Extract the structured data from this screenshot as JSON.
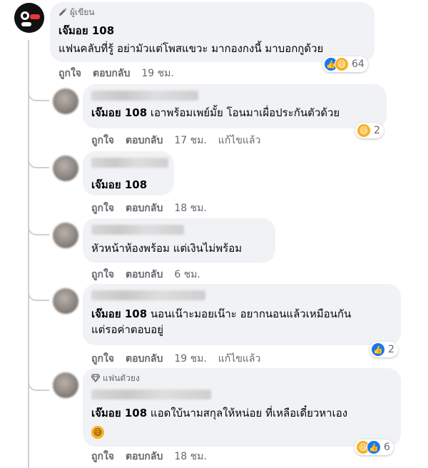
{
  "comments": [
    {
      "author_role": "ผู้เขียน",
      "name": "เจ๊มอย 108",
      "text": "แฟนคลับที่รู้ อย่ามัวแต่โพสแขวะ มากองกงนี้ มาบอกกูด้วย",
      "actions": {
        "like": "ถูกใจ",
        "reply": "ตอบกลับ",
        "time": "19 ชม."
      },
      "reactions": {
        "icons": [
          "like-icon",
          "haha-icon"
        ],
        "count": "64"
      }
    },
    {
      "name": "เจ๊มอย 108",
      "text": "เอาพร้อมเพย์มั้ย โอนมาเผื่อประกันตัวด้วย",
      "actions": {
        "like": "ถูกใจ",
        "reply": "ตอบกลับ",
        "time": "17 ชม.",
        "edited": "แก้ไขแล้ว"
      },
      "reactions": {
        "icons": [
          "haha-icon"
        ],
        "count": "2"
      }
    },
    {
      "name": "เจ๊มอย 108",
      "actions": {
        "like": "ถูกใจ",
        "reply": "ตอบกลับ",
        "time": "18 ชม."
      }
    },
    {
      "text": "หัวหน้าห้องพร้อม แต่เงินไม่พร้อม",
      "actions": {
        "like": "ถูกใจ",
        "reply": "ตอบกลับ",
        "time": "6 ชม."
      }
    },
    {
      "name": "เจ๊มอย 108",
      "text": "นอนเน๊าะมอยเน๊าะ อยากนอนแล้วเหมือนกัน",
      "text2": "แต่รอค่าตอบอยู่",
      "actions": {
        "like": "ถูกใจ",
        "reply": "ตอบกลับ",
        "time": "19 ชม.",
        "edited": "แก้ไขแล้ว"
      },
      "reactions": {
        "icons": [
          "like-icon"
        ],
        "count": "2"
      }
    },
    {
      "author_role": "แฟนตัวยง",
      "name": "เจ๊มอย 108",
      "text": "แอดใบ้นามสกุลให้หน่อย ที่เหลือเดี๋ยวหาเอง",
      "emoji": "grinning-sweat-emoji",
      "actions": {
        "like": "ถูกใจ",
        "reply": "ตอบกลับ",
        "time": "18 ชม."
      },
      "reactions": {
        "icons": [
          "haha-icon",
          "like-icon"
        ],
        "count": "6"
      }
    }
  ],
  "colors": {
    "bubble": "#f0f2f5",
    "meta": "#65676b",
    "like": "#1877f2",
    "haha": "#f7b125"
  }
}
